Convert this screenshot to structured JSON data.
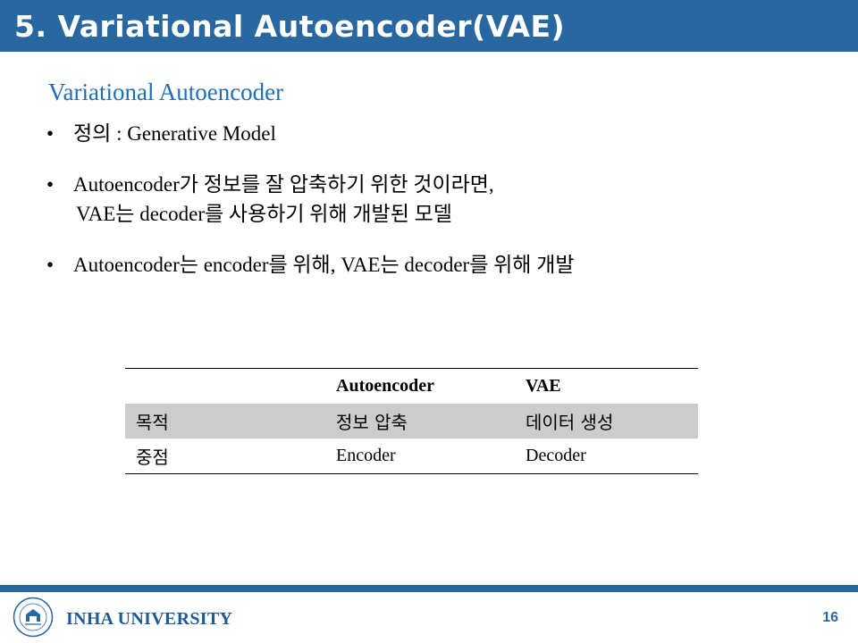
{
  "slide": {
    "title": "5. Variational Autoencoder(VAE)",
    "subtitle": "Variational Autoencoder",
    "bullets": [
      {
        "symbol": "•",
        "line1": "정의 : Generative Model",
        "line2": ""
      },
      {
        "symbol": "•",
        "line1": "Autoencoder가 정보를 잘 압축하기 위한 것이라면,",
        "line2": "VAE는 decoder를 사용하기 위해 개발된 모델"
      },
      {
        "symbol": "•",
        "line1": "Autoencoder는 encoder를 위해, VAE는 decoder를 위해 개발",
        "line2": ""
      }
    ],
    "table": {
      "headers": [
        "",
        "Autoencoder",
        "VAE"
      ],
      "rows": [
        [
          "목적",
          "정보 압축",
          "데이터 생성"
        ],
        [
          "중점",
          "Encoder",
          "Decoder"
        ]
      ]
    }
  },
  "footer": {
    "university": "INHA UNIVERSITY",
    "page_number": "16"
  },
  "colors": {
    "accent": "#2867a0",
    "subtitle": "#1f6fb4",
    "row_shade": "#cccccc"
  }
}
